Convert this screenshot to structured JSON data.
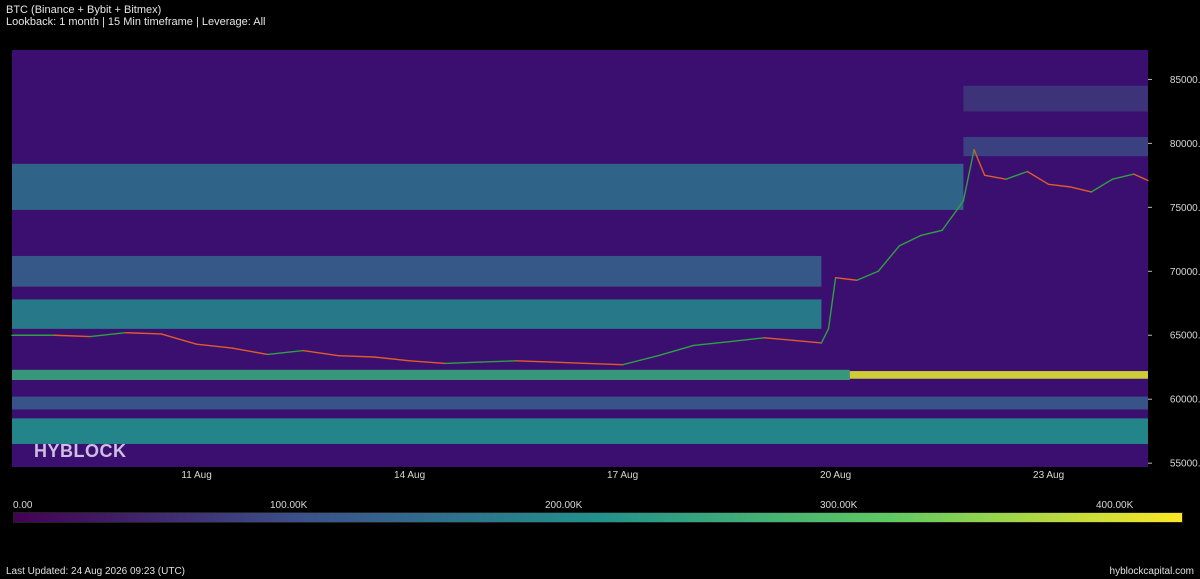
{
  "header": {
    "title": "BTC (Binance + Bybit + Bitmex)",
    "subtitle": "Lookback: 1 month | 15 Min timeframe | Leverage: All"
  },
  "watermark": "HYBLOCK",
  "footer": {
    "last_updated": "Last Updated: 24 Aug 2026 09:23 (UTC)",
    "site": "hyblockcapital.com"
  },
  "colors": {
    "background": "#000000",
    "heatmap_base": "#3b0f70",
    "price_up": "#2ea043",
    "price_down": "#e05a2a"
  },
  "colorbar": {
    "labels": [
      "0.00",
      "100.00K",
      "200.00K",
      "300.00K",
      "400.00K"
    ],
    "stops": [
      "#440154",
      "#3b528b",
      "#21918c",
      "#5ec962",
      "#fde725"
    ]
  },
  "chart_data": {
    "type": "heatmap",
    "title": "BTC (Binance + Bybit + Bitmex)",
    "x_ticks": [
      "11 Aug",
      "14 Aug",
      "17 Aug",
      "20 Aug",
      "23 Aug"
    ],
    "y_ticks": [
      "55000.0",
      "60000.0",
      "65000.0",
      "70000.0",
      "75000.0",
      "80000.0",
      "85000.0"
    ],
    "x_range_days": [
      8.4,
      24.4
    ],
    "y_range": [
      54700,
      87300
    ],
    "colorscale_range": [
      0,
      420000
    ],
    "liquidation_bands": [
      {
        "low": 56500,
        "high": 58500,
        "value": 210000,
        "from_day": 8.4,
        "to_day": 24.4
      },
      {
        "low": 59200,
        "high": 60200,
        "value": 120000,
        "from_day": 8.4,
        "to_day": 24.4
      },
      {
        "low": 61500,
        "high": 62300,
        "value": 250000,
        "from_day": 8.4,
        "to_day": 20.2
      },
      {
        "low": 61600,
        "high": 62200,
        "value": 400000,
        "from_day": 20.2,
        "to_day": 24.4
      },
      {
        "low": 65500,
        "high": 67800,
        "value": 190000,
        "from_day": 8.4,
        "to_day": 19.8
      },
      {
        "low": 68800,
        "high": 71200,
        "value": 130000,
        "from_day": 8.4,
        "to_day": 19.8
      },
      {
        "low": 74800,
        "high": 78400,
        "value": 150000,
        "from_day": 8.4,
        "to_day": 21.8
      },
      {
        "low": 79000,
        "high": 80500,
        "value": 90000,
        "from_day": 21.8,
        "to_day": 24.4
      },
      {
        "low": 82500,
        "high": 84500,
        "value": 70000,
        "from_day": 21.8,
        "to_day": 24.4
      }
    ],
    "price_series": {
      "name": "BTC",
      "x_days": [
        8.4,
        9.0,
        9.5,
        10.0,
        10.5,
        11.0,
        11.5,
        12.0,
        12.5,
        13.0,
        13.5,
        14.0,
        14.5,
        15.0,
        15.5,
        16.0,
        16.5,
        17.0,
        17.5,
        18.0,
        18.5,
        19.0,
        19.4,
        19.8,
        19.9,
        20.0,
        20.3,
        20.6,
        20.9,
        21.2,
        21.5,
        21.8,
        21.95,
        22.1,
        22.4,
        22.7,
        23.0,
        23.3,
        23.6,
        23.9,
        24.2,
        24.4
      ],
      "y": [
        65000,
        65000,
        64900,
        65200,
        65100,
        64300,
        64000,
        63500,
        63800,
        63400,
        63300,
        63000,
        62800,
        62900,
        63000,
        62900,
        62800,
        62700,
        63400,
        64200,
        64500,
        64800,
        64600,
        64400,
        65500,
        69500,
        69300,
        70000,
        72000,
        72800,
        73200,
        75500,
        79500,
        77500,
        77200,
        77800,
        76800,
        76600,
        76200,
        77200,
        77600,
        77100
      ]
    }
  }
}
